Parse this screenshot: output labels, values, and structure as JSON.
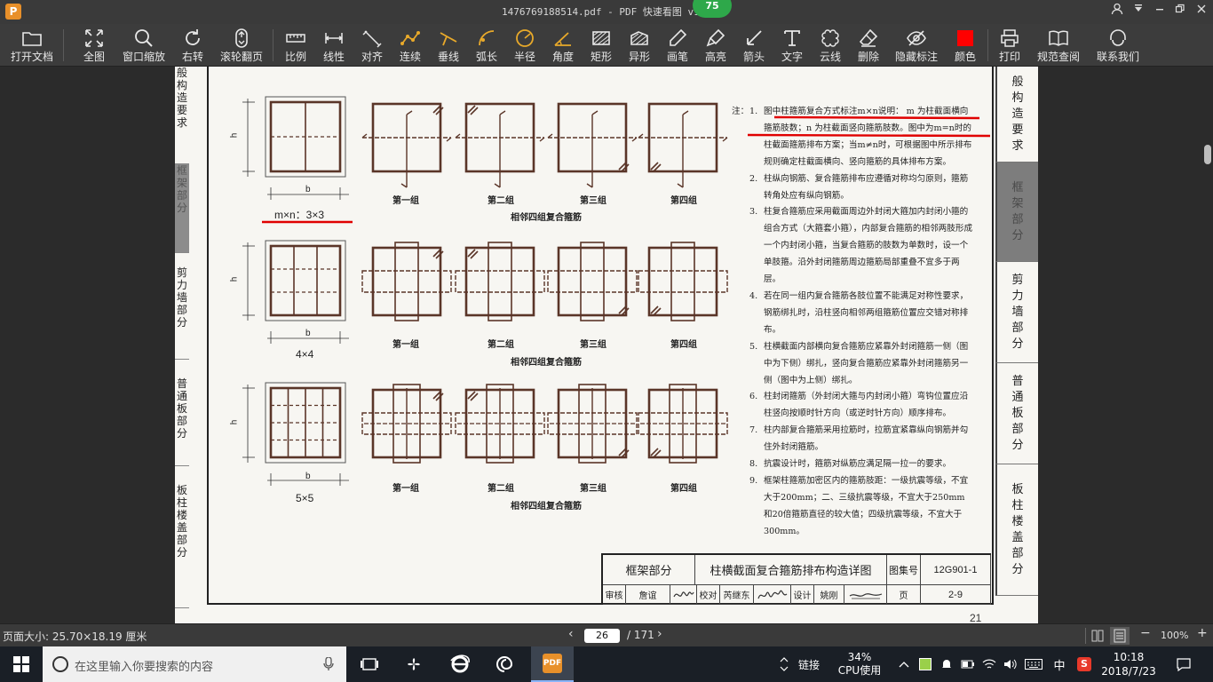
{
  "window": {
    "title": "1476769188514.pdf - PDF 快速看图 v1.9",
    "app_logo": "P",
    "badge": "75"
  },
  "toolbar": {
    "items": [
      {
        "label": "打开文档",
        "icon": "folder-icon"
      },
      {
        "label": "全图",
        "icon": "fit-all-icon"
      },
      {
        "label": "窗口缩放",
        "icon": "zoom-icon"
      },
      {
        "label": "右转",
        "icon": "rotate-right-icon"
      },
      {
        "label": "滚轮翻页",
        "icon": "mouse-wheel-icon"
      },
      {
        "label": "比例",
        "icon": "scale-icon"
      },
      {
        "label": "线性",
        "icon": "linear-dimension-icon"
      },
      {
        "label": "对齐",
        "icon": "aligned-dimension-icon"
      },
      {
        "label": "连续",
        "icon": "continuous-dimension-icon"
      },
      {
        "label": "垂线",
        "icon": "perpendicular-icon"
      },
      {
        "label": "弧长",
        "icon": "arc-length-icon"
      },
      {
        "label": "半径",
        "icon": "radius-icon"
      },
      {
        "label": "角度",
        "icon": "angle-icon"
      },
      {
        "label": "矩形",
        "icon": "rectangle-icon"
      },
      {
        "label": "异形",
        "icon": "polygon-icon"
      },
      {
        "label": "画笔",
        "icon": "pen-icon"
      },
      {
        "label": "高亮",
        "icon": "highlighter-icon"
      },
      {
        "label": "箭头",
        "icon": "arrow-icon"
      },
      {
        "label": "文字",
        "icon": "text-icon"
      },
      {
        "label": "云线",
        "icon": "cloud-icon"
      },
      {
        "label": "删除",
        "icon": "eraser-icon"
      },
      {
        "label": "隐藏标注",
        "icon": "hide-eye-icon"
      },
      {
        "label": "颜色",
        "icon": "color-swatch-icon",
        "color": "#ff0000"
      },
      {
        "label": "打印",
        "icon": "printer-icon"
      },
      {
        "label": "规范查阅",
        "icon": "book-icon"
      },
      {
        "label": "联系我们",
        "icon": "headset-icon"
      }
    ]
  },
  "page": {
    "left_tabs": [
      "般构造要求",
      "框架部分",
      "剪力墙部分",
      "普通板部分",
      "板柱楼盖部分"
    ],
    "right_tabs": [
      "般构造要求",
      "框架部分",
      "剪力墙部分",
      "普通板部分",
      "板柱楼盖部分"
    ],
    "rows": [
      {
        "dim": "m×n：3×3",
        "b": "b",
        "h": "h"
      },
      {
        "dim": "4×4",
        "b": "b",
        "h": "h"
      },
      {
        "dim": "5×5",
        "b": "b",
        "h": "h"
      }
    ],
    "group_labels": [
      "第一组",
      "第二组",
      "第三组",
      "第四组"
    ],
    "caption": "相邻四组复合箍筋",
    "notes_head": "注：",
    "notes": [
      {
        "num": "1.",
        "text": "图中柱箍筋复合方式标注m×n说明： m 为柱截面横向箍筋肢数；n 为柱截面竖向箍筋肢数。图中为m=n时的柱截面箍筋排布方案；当m≠n时，可根据图中所示排布规则确定柱截面横向、竖向箍筋的具体排布方案。"
      },
      {
        "num": "2.",
        "text": "柱纵向钢筋、复合箍筋排布应遵循对称均匀原则，箍筋转角处应有纵向钢筋。"
      },
      {
        "num": "3.",
        "text": "柱复合箍筋应采用截面周边外封闭大箍加内封闭小箍的组合方式（大箍套小箍），内部复合箍筋的相邻两肢形成一个内封闭小箍，当复合箍筋的肢数为单数时，设一个单肢箍。沿外封闭箍筋周边箍筋局部重叠不宜多于两层。"
      },
      {
        "num": "4.",
        "text": "若在同一组内复合箍筋各肢位置不能满足对称性要求，钢筋绑扎时，沿柱竖向相邻两组箍筋位置应交错对称排布。"
      },
      {
        "num": "5.",
        "text": "柱横截面内部横向复合箍筋应紧靠外封闭箍筋一侧（图中为下侧）绑扎，竖向复合箍筋应紧靠外封闭箍筋另一侧（图中为上侧）绑扎。"
      },
      {
        "num": "6.",
        "text": "柱封闭箍筋（外封闭大箍与内封闭小箍）弯钩位置应沿柱竖向按顺时针方向（或逆时针方向）顺序排布。"
      },
      {
        "num": "7.",
        "text": "柱内部复合箍筋采用拉筋时，拉筋宜紧靠纵向钢筋并勾住外封闭箍筋。"
      },
      {
        "num": "8.",
        "text": "抗震设计时，箍筋对纵筋应满足隔一拉一的要求。"
      },
      {
        "num": "9.",
        "text": "框架柱箍筋加密区内的箍筋肢距：一级抗震等级，不宜大于200mm；二、三级抗震等级，不宜大于250mm和20倍箍筋直径的较大值；四级抗震等级，不宜大于300mm。"
      }
    ],
    "title_block": {
      "section": "框架部分",
      "title": "柱横截面复合箍筋排布构造详图",
      "atlas_label": "图集号",
      "atlas_no": "12G901-1",
      "review": "审核",
      "reviewer": "詹谊",
      "check": "校对",
      "checker": "芮继东",
      "design": "设计",
      "designer": "姚刚",
      "page_label": "页",
      "page_no": "2-9"
    },
    "sheet_number": "21"
  },
  "statusbar": {
    "page_size": "页面大小: 25.70×18.19 厘米",
    "current_page": "26",
    "total_pages": "/ 171",
    "zoom": "100%"
  },
  "taskbar": {
    "search_placeholder": "在这里输入你要搜索的内容",
    "link_label": "链接",
    "cpu_percent": "34%",
    "cpu_label": "CPU使用",
    "ime": "中",
    "time": "10:18",
    "date": "2018/7/23"
  },
  "colors": {
    "annotation_red": "#e00000",
    "stirrup_brown": "#5a3528"
  }
}
